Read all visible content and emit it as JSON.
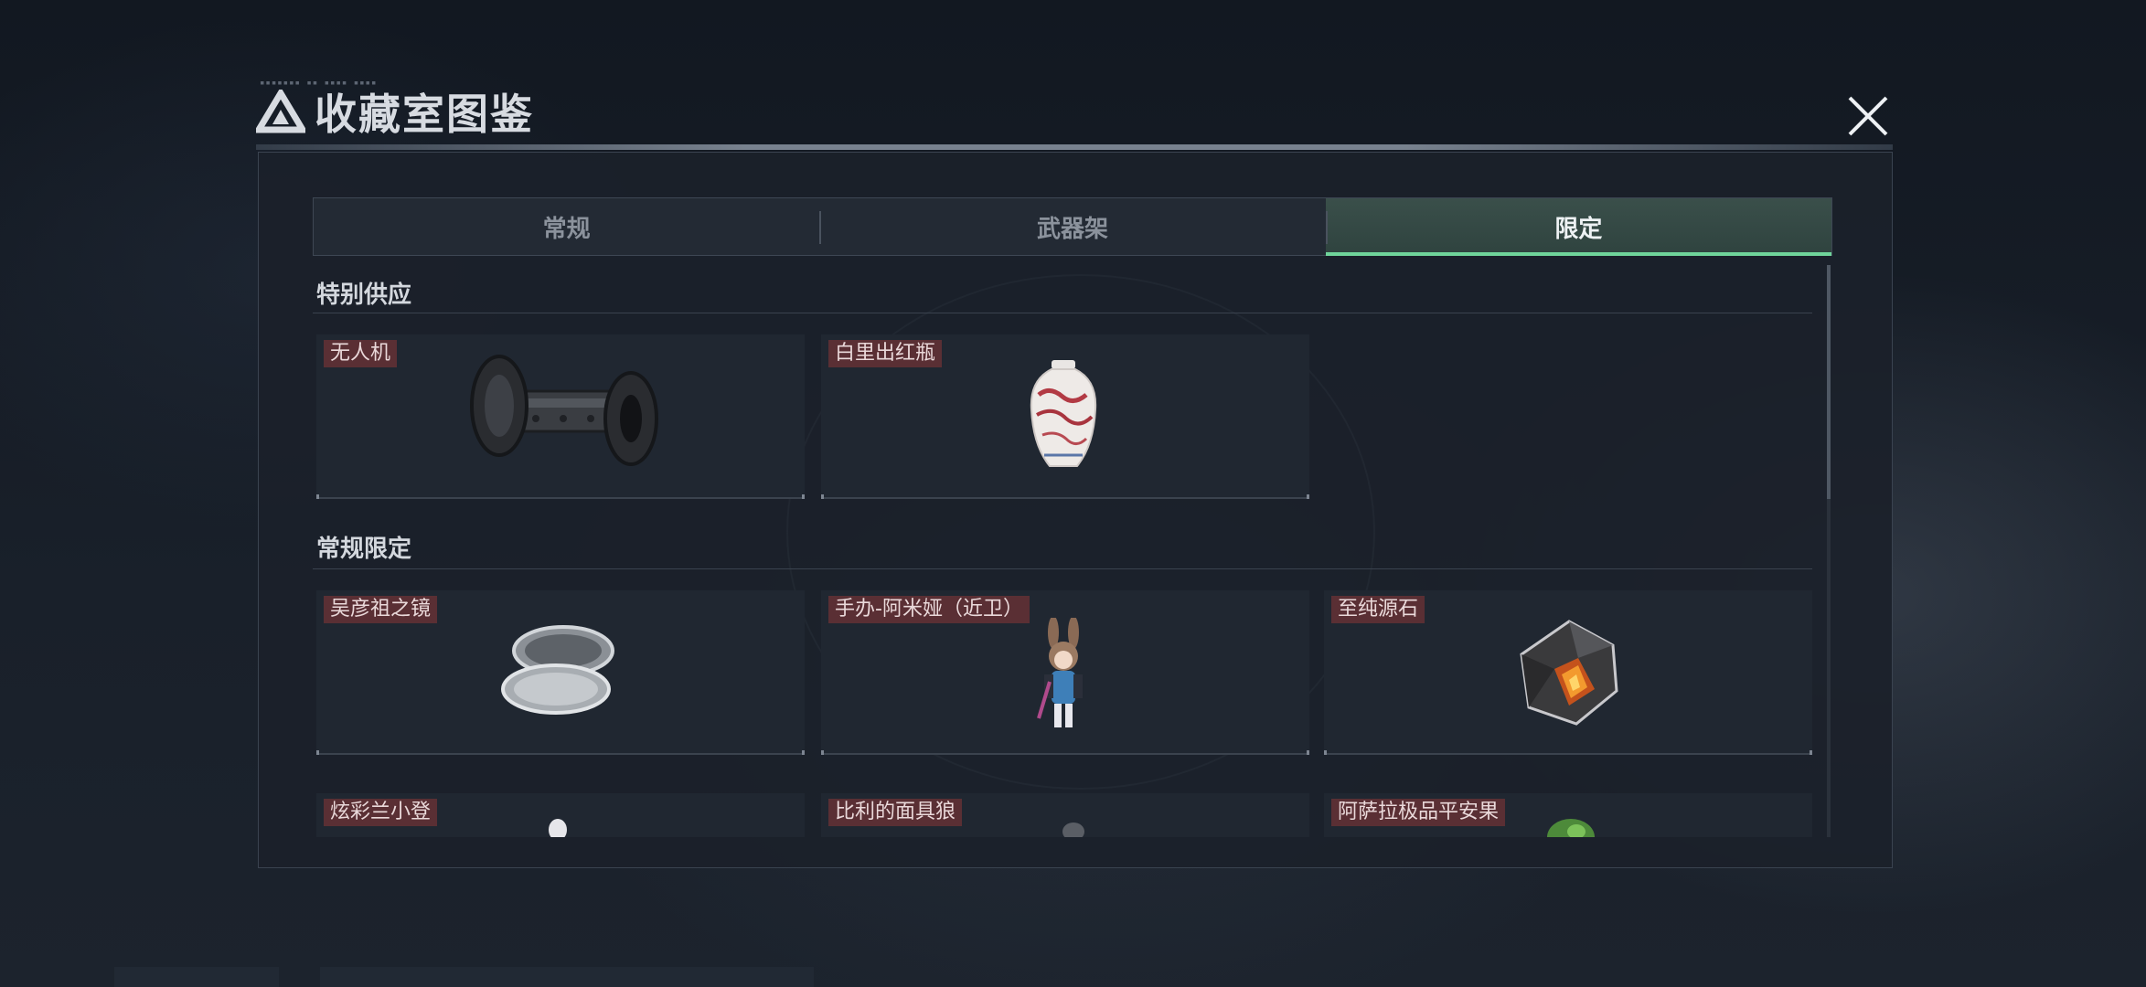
{
  "window": {
    "title": "收藏室图鉴",
    "close_icon": "close-icon"
  },
  "tabs": [
    {
      "label": "常规",
      "active": false
    },
    {
      "label": "武器架",
      "active": false
    },
    {
      "label": "限定",
      "active": true
    }
  ],
  "sections": [
    {
      "title": "特别供应",
      "items": [
        {
          "label": "无人机",
          "icon": "drone-icon"
        },
        {
          "label": "白里出红瓶",
          "icon": "vase-icon"
        }
      ]
    },
    {
      "title": "常规限定",
      "items": [
        {
          "label": "吴彦祖之镜",
          "icon": "mirror-icon"
        },
        {
          "label": "手办-阿米娅（近卫）",
          "icon": "figurine-icon"
        },
        {
          "label": "至纯源石",
          "icon": "originium-icon"
        },
        {
          "label": "炫彩兰小登",
          "icon": "stool-icon"
        },
        {
          "label": "比利的面具狼",
          "icon": "wolf-mask-icon"
        },
        {
          "label": "阿萨拉极品平安果",
          "icon": "apple-icon"
        }
      ]
    }
  ],
  "colors": {
    "accent_green": "#6fd49a",
    "label_bg": "#5a2f34",
    "panel_bg": "#1b212a"
  }
}
